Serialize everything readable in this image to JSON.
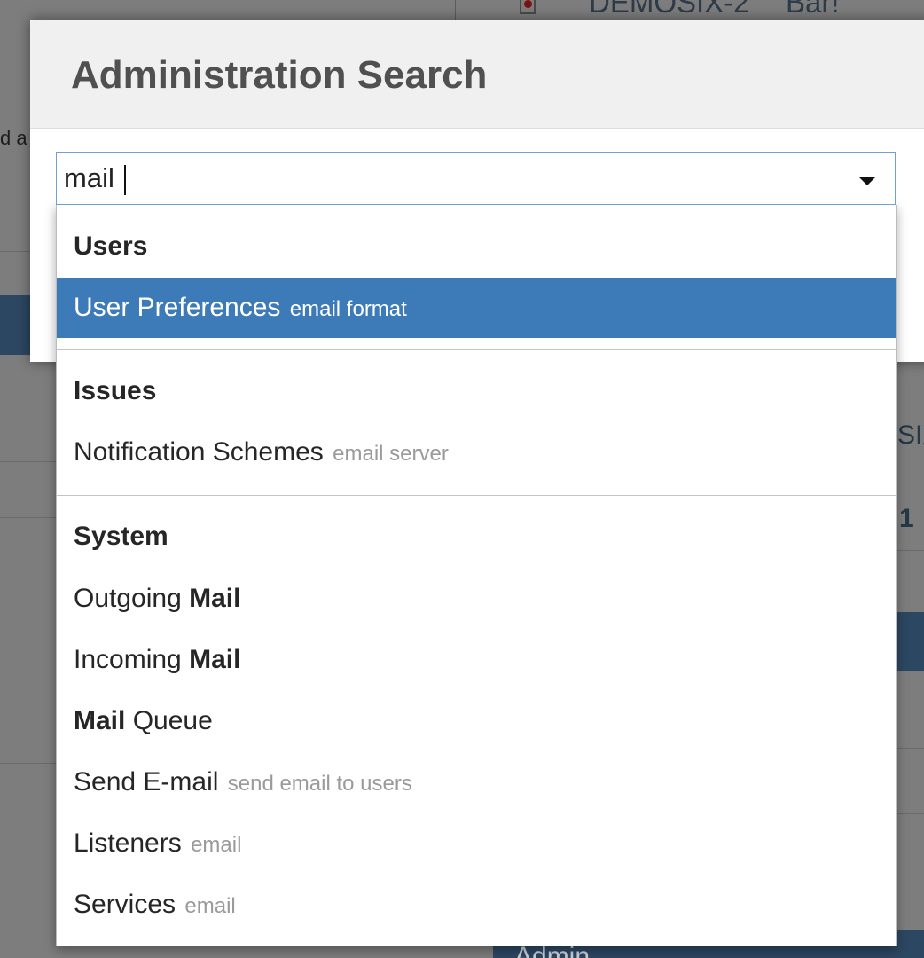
{
  "background": {
    "top_key": "DEMOSIX-2",
    "top_summary": "Bar!",
    "left_text": "d a",
    "right_fragments": [
      "SIX",
      "1"
    ],
    "footer_tab": "Admin"
  },
  "dialog": {
    "title": "Administration Search"
  },
  "search": {
    "value": "mail"
  },
  "results": {
    "groups": [
      {
        "label": "Users",
        "items": [
          {
            "label": "User Preferences",
            "hint": "email format",
            "selected": true
          }
        ]
      },
      {
        "label": "Issues",
        "items": [
          {
            "label": "Notification Schemes",
            "hint": "email server"
          }
        ]
      },
      {
        "label": "System",
        "items": [
          {
            "prefix": "Outgoing ",
            "match": "Mail"
          },
          {
            "prefix": "Incoming ",
            "match": "Mail"
          },
          {
            "match": "Mail",
            "suffix": " Queue"
          },
          {
            "label": "Send E-mail",
            "hint": "send email to users"
          },
          {
            "label": "Listeners",
            "hint": "email"
          },
          {
            "label": "Services",
            "hint": "email"
          }
        ]
      }
    ]
  },
  "colors": {
    "selected_bg": "#3d7ab8",
    "hint_text": "#9a9a9a",
    "focus_border": "#6f9fd4"
  }
}
